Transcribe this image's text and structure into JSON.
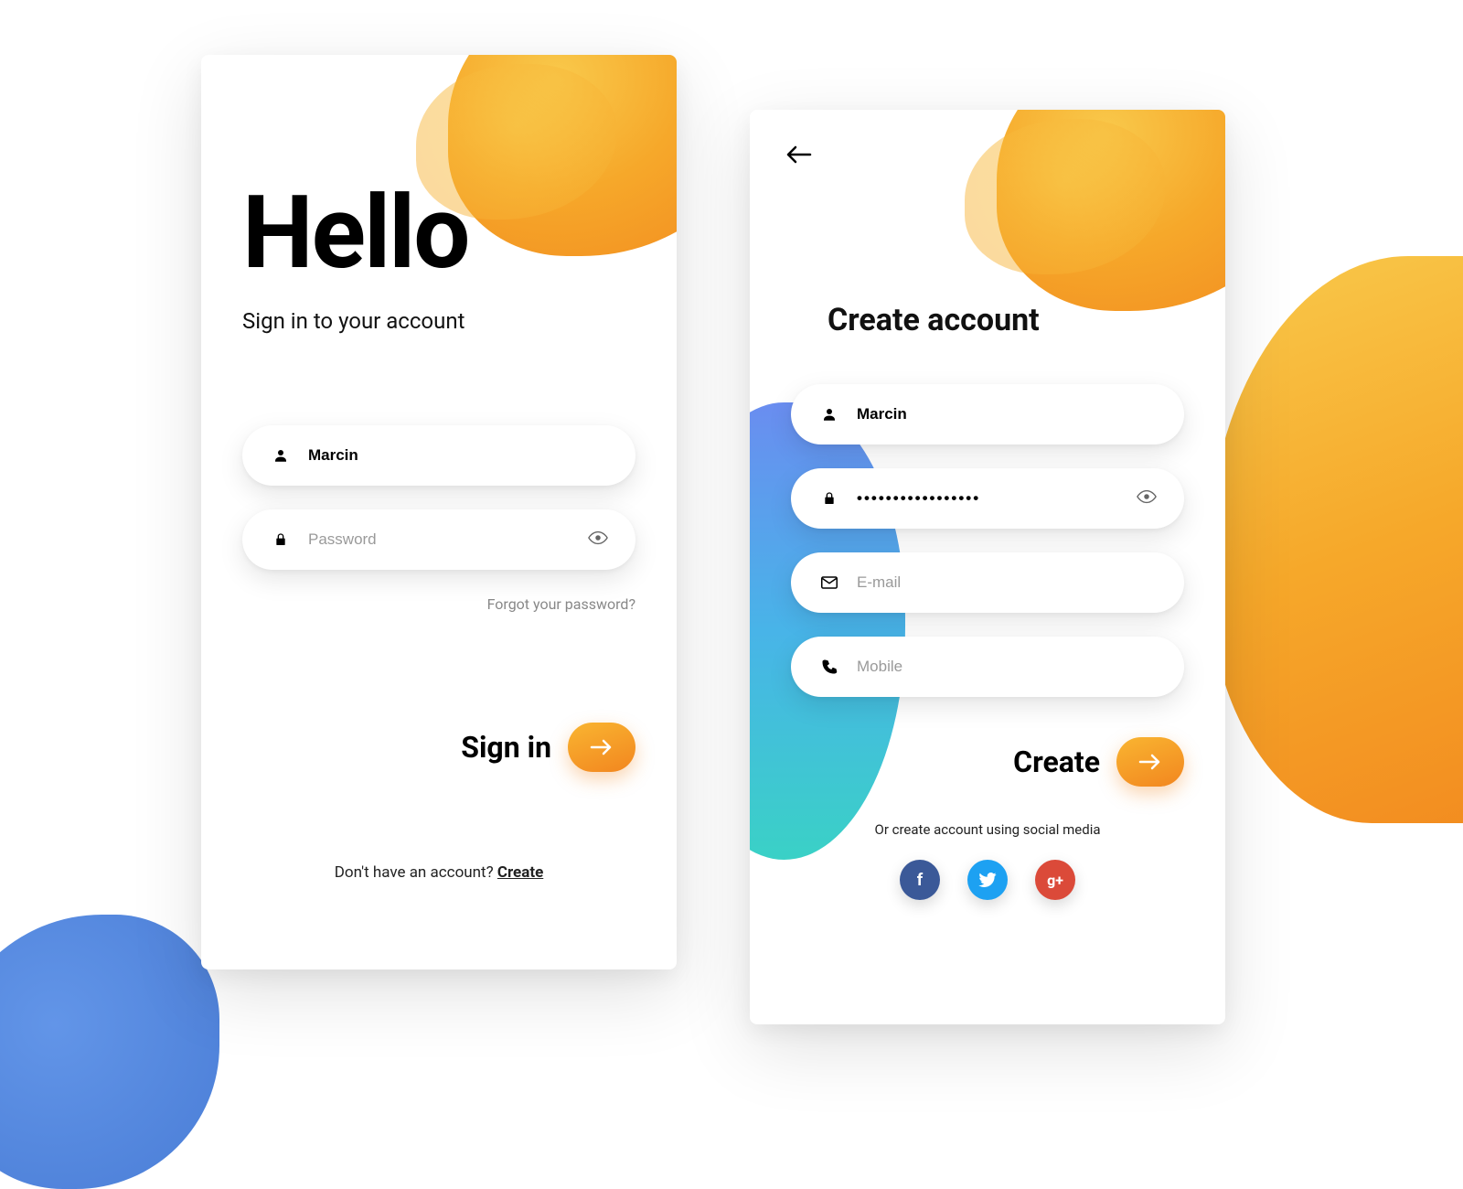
{
  "signin": {
    "title": "Hello",
    "subtitle": "Sign in to your account",
    "username_value": "Marcin",
    "password_placeholder": "Password",
    "forgot": "Forgot your password?",
    "action_label": "Sign in",
    "footer_prefix": "Don't have an account? ",
    "footer_link": "Create"
  },
  "signup": {
    "title": "Create account",
    "name_value": "Marcin",
    "password_value": "•••••••••••••••••",
    "email_placeholder": "E-mail",
    "mobile_placeholder": "Mobile",
    "action_label": "Create",
    "social_text": "Or create account using social media",
    "social": {
      "facebook": "f",
      "twitter": "",
      "googleplus": "g+"
    }
  },
  "colors": {
    "accent_orange_start": "#f9b531",
    "accent_orange_end": "#f2861f",
    "blue_blob": "#6295e8",
    "teal_blob": "#3ad1c6"
  }
}
